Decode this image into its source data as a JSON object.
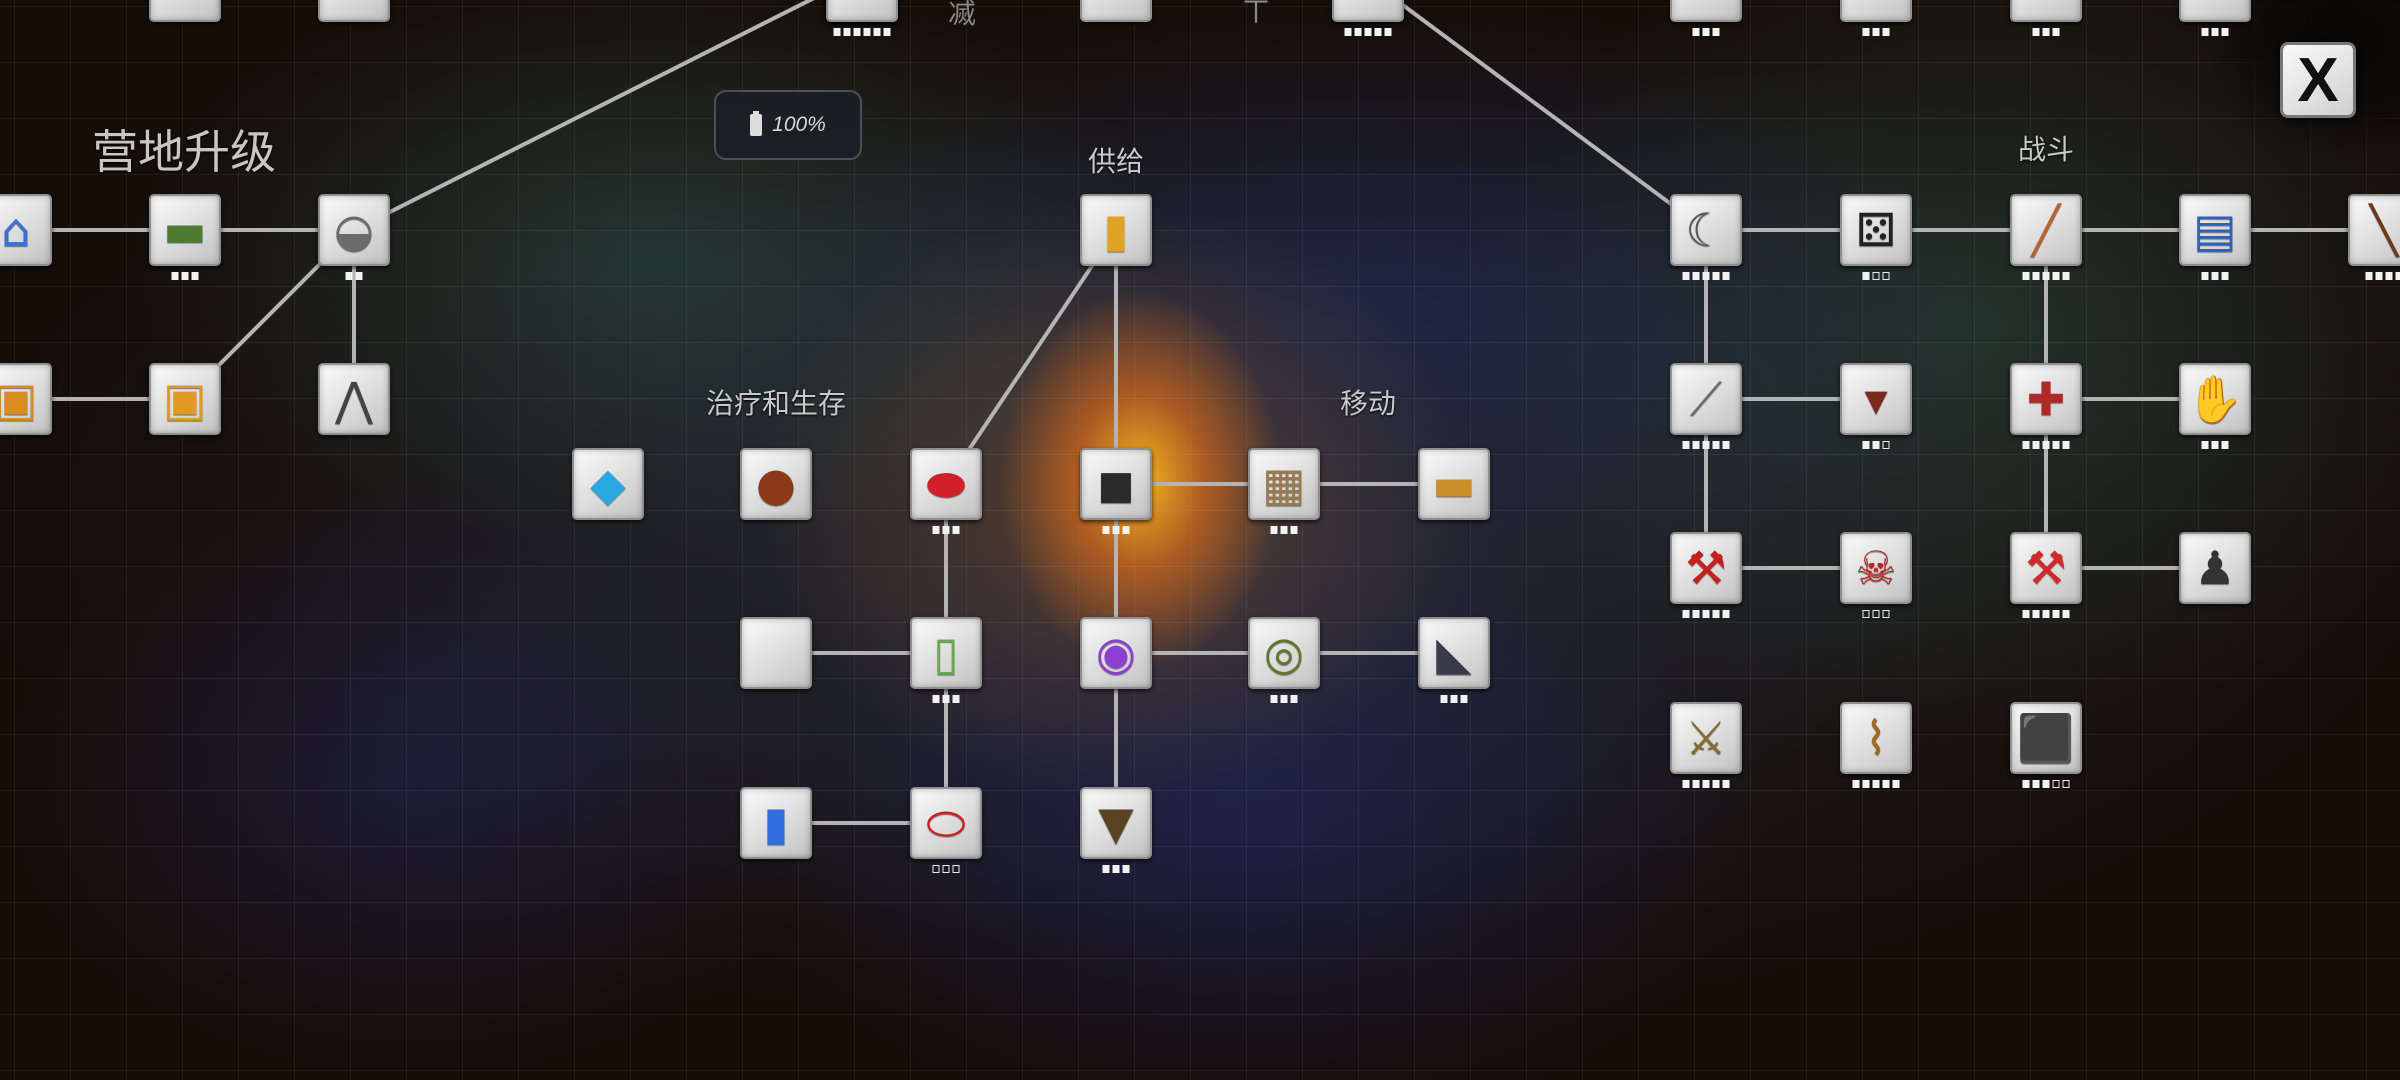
{
  "battery": {
    "icon": "battery-icon",
    "text": "100%"
  },
  "close_button": {
    "label": "X",
    "icon": "close-icon"
  },
  "categories": [
    {
      "id": "camp-upgrade",
      "label": "营地升级",
      "size": "big"
    },
    {
      "id": "supply",
      "label": "供给"
    },
    {
      "id": "healing-survival",
      "label": "治疗和生存"
    },
    {
      "id": "movement",
      "label": "移动"
    },
    {
      "id": "combat",
      "label": "战斗"
    }
  ],
  "top_partial_glyphs": [
    "㓕",
    "ㄒ"
  ],
  "nodes": [
    {
      "id": "top-a",
      "icon": "partial-icon",
      "glyph": "",
      "color": "#888",
      "level": 0,
      "max": 0
    },
    {
      "id": "top-b",
      "icon": "partial-icon",
      "glyph": "",
      "color": "#888",
      "level": 0,
      "max": 0
    },
    {
      "id": "top-c",
      "icon": "partial-icon",
      "glyph": "",
      "color": "#888",
      "level": 0,
      "max": 0
    },
    {
      "id": "top-d",
      "icon": "partial-icon",
      "glyph": "",
      "color": "#888",
      "level": 6,
      "max": 6
    },
    {
      "id": "top-e",
      "icon": "partial-icon",
      "glyph": "",
      "color": "#888",
      "level": 0,
      "max": 0
    },
    {
      "id": "top-f",
      "icon": "partial-icon",
      "glyph": "",
      "color": "#888",
      "level": 5,
      "max": 5
    },
    {
      "id": "top-g",
      "icon": "partial-icon",
      "glyph": "",
      "color": "#888",
      "level": 3,
      "max": 3
    },
    {
      "id": "top-h",
      "icon": "partial-icon",
      "glyph": "",
      "color": "#888",
      "level": 3,
      "max": 3
    },
    {
      "id": "top-i",
      "icon": "partial-icon",
      "glyph": "",
      "color": "#888",
      "level": 3,
      "max": 3
    },
    {
      "id": "top-j",
      "icon": "partial-icon",
      "glyph": "",
      "color": "#888",
      "level": 3,
      "max": 3
    },
    {
      "id": "camp-house",
      "icon": "house-icon",
      "glyph": "⌂",
      "color": "#3b6fd6",
      "level": 0,
      "max": 0
    },
    {
      "id": "camp-sleeping-bag",
      "icon": "sleeping-bag-icon",
      "glyph": "▬",
      "color": "#4f7a32",
      "level": 3,
      "max": 3
    },
    {
      "id": "camp-cooking-pot",
      "icon": "cooking-pot-icon",
      "glyph": "◒",
      "color": "#6b6b6b",
      "level": 2,
      "max": 2
    },
    {
      "id": "camp-chest-left",
      "icon": "chest-icon",
      "glyph": "▣",
      "color": "#d98b1c",
      "level": 0,
      "max": 0
    },
    {
      "id": "camp-chest",
      "icon": "chest-icon",
      "glyph": "▣",
      "color": "#e09a22",
      "level": 0,
      "max": 0
    },
    {
      "id": "camp-tripod",
      "icon": "tripod-icon",
      "glyph": "⋀",
      "color": "#444",
      "level": 0,
      "max": 0
    },
    {
      "id": "supply-can",
      "icon": "canned-food-icon",
      "glyph": "▮",
      "color": "#e0a323",
      "level": 0,
      "max": 0
    },
    {
      "id": "heal-crystal",
      "icon": "blue-crystal-icon",
      "glyph": "◆",
      "color": "#2aa9e0",
      "level": 0,
      "max": 0
    },
    {
      "id": "heal-bottle",
      "icon": "hot-water-bottle-icon",
      "glyph": "●",
      "color": "#8b3a1c",
      "level": 0,
      "max": 0
    },
    {
      "id": "heal-blood-bag",
      "icon": "blood-bag-icon",
      "glyph": "⬬",
      "color": "#d0202a",
      "level": 3,
      "max": 3
    },
    {
      "id": "move-kneepads",
      "icon": "kneepads-icon",
      "glyph": "◼",
      "color": "#2a2a2a",
      "level": 3,
      "max": 3
    },
    {
      "id": "move-net",
      "icon": "net-icon",
      "glyph": "▦",
      "color": "#9b7b4e",
      "level": 3,
      "max": 3
    },
    {
      "id": "move-skateboard",
      "icon": "skateboard-icon",
      "glyph": "▬",
      "color": "#c9902a",
      "level": 0,
      "max": 0
    },
    {
      "id": "heal-empty",
      "icon": "empty-slot-icon",
      "glyph": "",
      "color": "#ccc",
      "level": 0,
      "max": 0
    },
    {
      "id": "heal-can",
      "icon": "medical-can-icon",
      "glyph": "▯",
      "color": "#6aa84f",
      "level": 3,
      "max": 3
    },
    {
      "id": "move-wristbands",
      "icon": "wristbands-icon",
      "glyph": "◉",
      "color": "#8e3fd0",
      "level": 0,
      "max": 0
    },
    {
      "id": "move-tape",
      "icon": "tape-roll-icon",
      "glyph": "◎",
      "color": "#5d7a2c",
      "level": 3,
      "max": 3
    },
    {
      "id": "move-shoe",
      "icon": "shoe-icon",
      "glyph": "◣",
      "color": "#3a3a4a",
      "level": 3,
      "max": 3
    },
    {
      "id": "heal-energy",
      "icon": "energy-drink-icon",
      "glyph": "▮",
      "color": "#2f6fe0",
      "level": 0,
      "max": 0
    },
    {
      "id": "heal-pills",
      "icon": "pills-icon",
      "glyph": "⬭",
      "color": "#d41c1c",
      "level": 0,
      "max": 3
    },
    {
      "id": "move-brush",
      "icon": "brush-icon",
      "glyph": "▼",
      "color": "#5a4322",
      "level": 3,
      "max": 3
    },
    {
      "id": "combat-sickle",
      "icon": "sickle-icon",
      "glyph": "☾",
      "color": "#555",
      "level": 5,
      "max": 5
    },
    {
      "id": "combat-dice",
      "icon": "dice-icon",
      "glyph": "⚄",
      "color": "#222",
      "level": 1,
      "max": 3
    },
    {
      "id": "combat-bat",
      "icon": "baseball-bat-icon",
      "glyph": "╱",
      "color": "#b8642a",
      "level": 5,
      "max": 5
    },
    {
      "id": "combat-card",
      "icon": "portrait-card-icon",
      "glyph": "▤",
      "color": "#2b62c0",
      "level": 3,
      "max": 3
    },
    {
      "id": "combat-rifle",
      "icon": "rifle-icon",
      "glyph": "╲",
      "color": "#6b3a1a",
      "level": 4,
      "max": 4
    },
    {
      "id": "combat-machete",
      "icon": "machete-icon",
      "glyph": "⟋",
      "color": "#6d6d6d",
      "level": 5,
      "max": 5
    },
    {
      "id": "combat-fangs",
      "icon": "fangs-icon",
      "glyph": "▾",
      "color": "#7a2a1a",
      "level": 2,
      "max": 3
    },
    {
      "id": "combat-wrench",
      "icon": "pipe-wrench-icon",
      "glyph": "✚",
      "color": "#b02828",
      "level": 5,
      "max": 5
    },
    {
      "id": "combat-bandage-hand",
      "icon": "bandaged-hand-icon",
      "glyph": "✋",
      "color": "#9a8f80",
      "level": 3,
      "max": 3
    },
    {
      "id": "combat-axe",
      "icon": "axe-icon",
      "glyph": "⚒",
      "color": "#c61f1f",
      "level": 5,
      "max": 5
    },
    {
      "id": "combat-skull",
      "icon": "skull-icon",
      "glyph": "☠",
      "color": "#c21e1e",
      "level": 0,
      "max": 3
    },
    {
      "id": "combat-axe-2",
      "icon": "fire-axe-icon",
      "glyph": "⚒",
      "color": "#d22a2a",
      "level": 5,
      "max": 5
    },
    {
      "id": "combat-joystick",
      "icon": "gear-shift-icon",
      "glyph": "♟",
      "color": "#333",
      "level": 0,
      "max": 0
    },
    {
      "id": "combat-sword",
      "icon": "sword-icon",
      "glyph": "⚔",
      "color": "#8a6a2a",
      "level": 5,
      "max": 5
    },
    {
      "id": "combat-hook",
      "icon": "hook-blade-icon",
      "glyph": "⌇",
      "color": "#a06a1a",
      "level": 5,
      "max": 5
    },
    {
      "id": "combat-shield",
      "icon": "riot-shield-icon",
      "glyph": "⬛",
      "color": "#2d2d2d",
      "level": 3,
      "max": 5
    }
  ]
}
